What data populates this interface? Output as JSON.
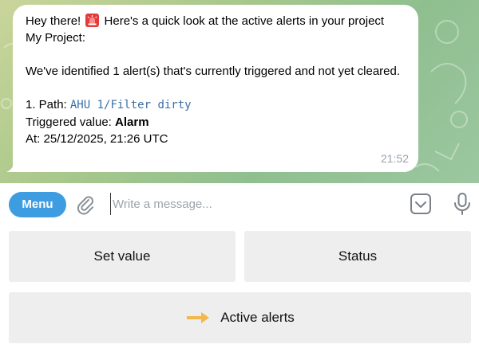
{
  "message": {
    "greeting": "Hey there!",
    "intro_rest": "Here's a quick look at the active alerts in your project",
    "project": "My Project:",
    "summary": "We've identified 1 alert(s) that's currently triggered and not yet cleared.",
    "item_prefix": "1. Path: ",
    "path": "AHU 1/Filter dirty",
    "triggered_label": "Triggered value: ",
    "triggered_value": "Alarm",
    "at_line": "At: 25/12/2025, 21:26 UTC",
    "time": "21:52",
    "icon": "siren-emoji-icon"
  },
  "input_bar": {
    "menu_label": "Menu",
    "placeholder": "Write a message...",
    "icons": [
      "paperclip-icon",
      "keyboard-toggle-icon",
      "microphone-icon"
    ],
    "menu_color": "#3d9de0"
  },
  "keyboard": {
    "set_value": "Set value",
    "status": "Status",
    "active_alerts": "Active alerts",
    "active_icon": "arrow-right-icon",
    "arrow_color": "#f2b84b"
  }
}
